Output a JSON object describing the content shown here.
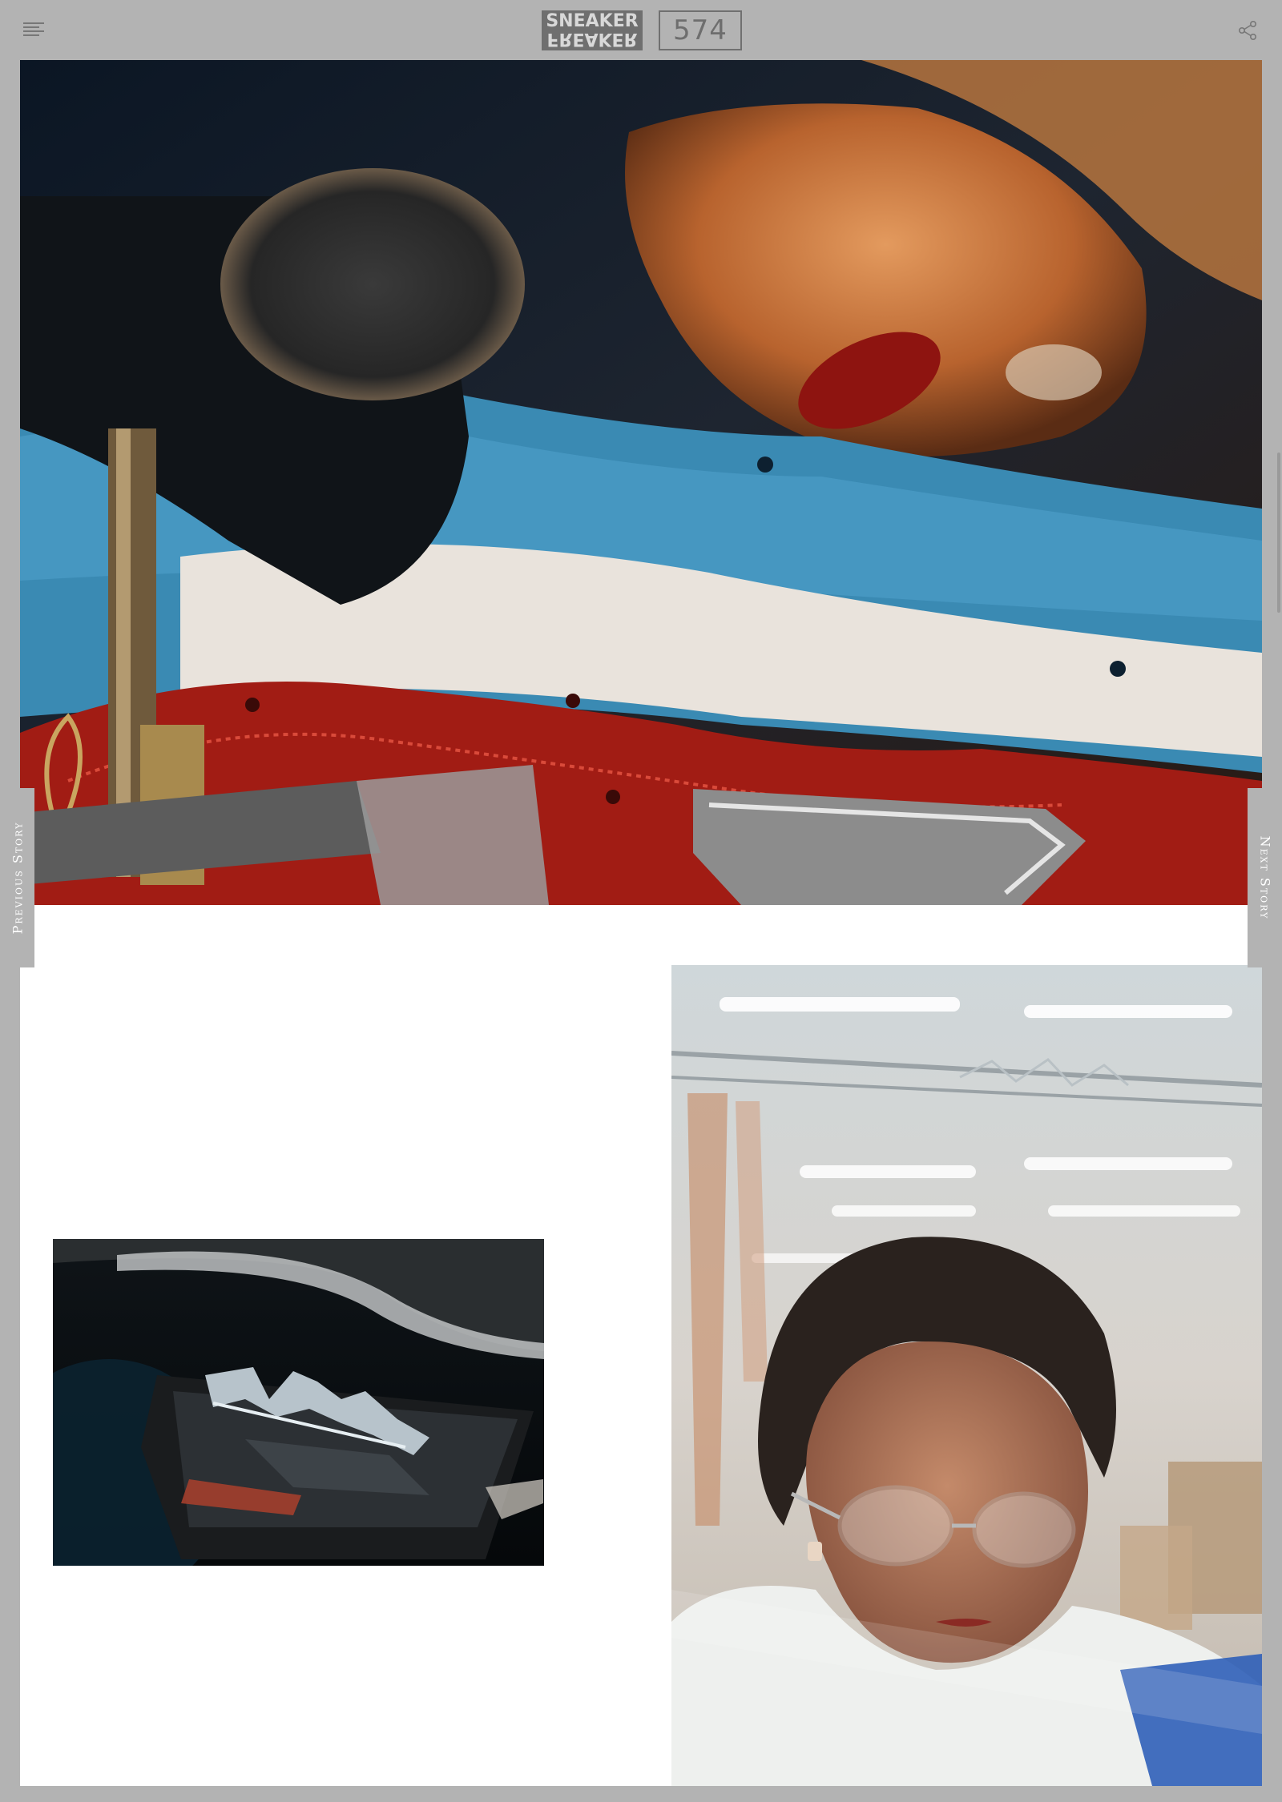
{
  "header": {
    "menu_icon": "hamburger-menu-icon",
    "logo": {
      "line1": "SNEAKER",
      "line2": "FREAKER"
    },
    "issue_number": "574",
    "share_icon": "share-icon"
  },
  "article": {
    "photos": [
      {
        "subject": "sewing-machine-closeup"
      },
      {
        "subject": "embossing-plate"
      },
      {
        "subject": "factory-worker"
      }
    ]
  },
  "navigation": {
    "previous_label": "Previous Story",
    "next_label": "Next Story"
  },
  "colors": {
    "chrome": "#b3b3b3",
    "page": "#ffffff",
    "logo_block": "#6f6f6f",
    "side_label": "#ffffff"
  }
}
